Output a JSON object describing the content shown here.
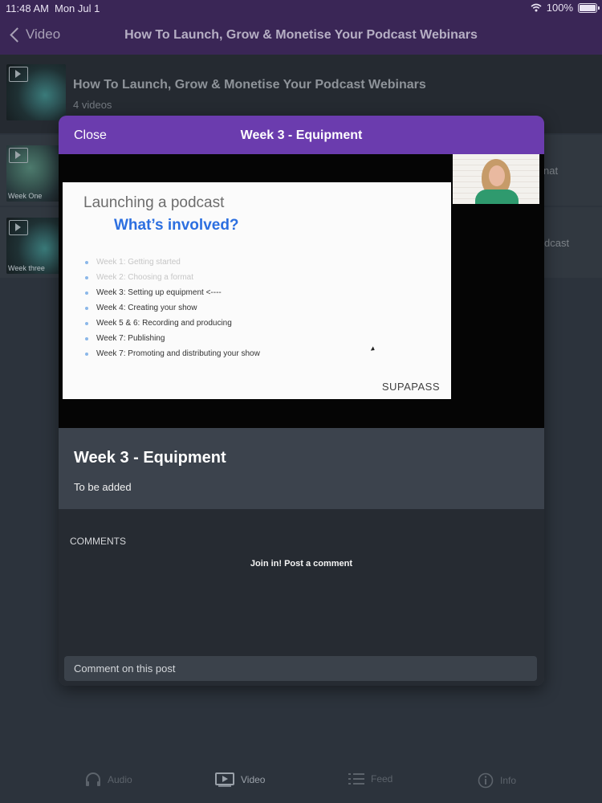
{
  "status_bar": {
    "time": "11:48 AM",
    "date": "Mon Jul 1",
    "battery": "100%"
  },
  "nav": {
    "back_label": "Video",
    "title": "How To Launch, Grow & Monetise Your Podcast Webinars"
  },
  "playlist": {
    "title": "How To Launch, Grow & Monetise Your Podcast Webinars",
    "count": "4 videos",
    "items": [
      {
        "thumb_caption": "Week One",
        "side_text": "nat"
      },
      {
        "thumb_caption": "Week three",
        "side_text": "dcast"
      }
    ]
  },
  "modal": {
    "close_label": "Close",
    "title": "Week 3 - Equipment",
    "video": {
      "slide_title": "Launching a podcast",
      "slide_subtitle": "What’s involved?",
      "slide_items": [
        "Week 1: Getting started",
        "Week 2: Choosing a format",
        "Week 3: Setting up equipment <----",
        "Week 4: Creating your show",
        "Week 5 & 6: Recording and producing",
        "Week 7: Publishing",
        "Week 7: Promoting and distributing your show"
      ],
      "slide_logo": "SUPAPASS"
    },
    "info_title": "Week 3 - Equipment",
    "info_desc": "To be added",
    "comments_label": "COMMENTS",
    "comments_prompt": "Join in! Post a comment",
    "comment_placeholder": "Comment on this post"
  },
  "tabs": [
    {
      "label": "Audio",
      "icon": "headphones-icon"
    },
    {
      "label": "Video",
      "icon": "video-icon",
      "active": true
    },
    {
      "label": "Feed",
      "icon": "list-icon"
    },
    {
      "label": "Info",
      "icon": "info-icon"
    }
  ],
  "colors": {
    "nav_bg": "#3a2656",
    "modal_header": "#6b3cae",
    "slide_accent": "#2c6fe0"
  }
}
